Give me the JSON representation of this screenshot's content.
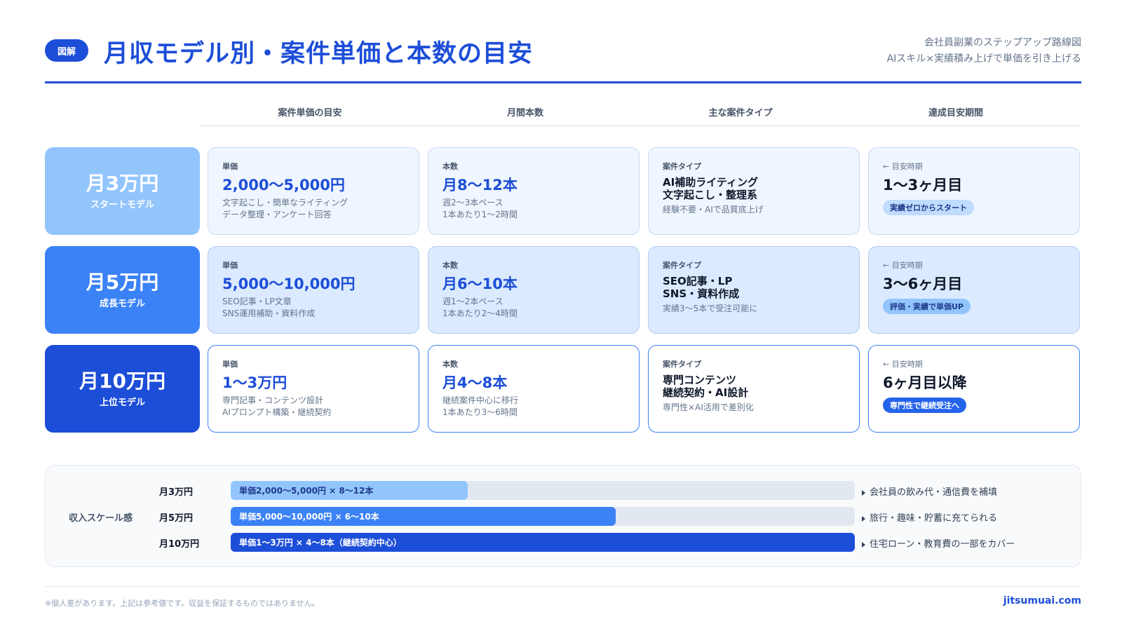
{
  "header": {
    "badge": "図解",
    "title": "月収モデル別・案件単価と本数の目安",
    "subtitle_line1": "会社員副業のステップアップ路線図",
    "subtitle_line2": "AIスキル×実績積み上げで単価を引き上げる"
  },
  "columns": [
    "案件単価の目安",
    "月間本数",
    "主な案件タイプ",
    "達成目安期間"
  ],
  "models": [
    {
      "amount": "月3万円",
      "name": "スタートモデル",
      "color": "#93c5fd",
      "text_color": "#ffffff",
      "price_label": "単価",
      "price": "2,000〜5,000円",
      "price_note1": "文字起こし・簡単なライティング",
      "price_note2": "データ整理・アンケート回答",
      "count_label": "本数",
      "count": "月8〜12本",
      "count_note1": "週2〜3本ペース",
      "count_note2": "1本あたり1〜2時間",
      "type_label": "案件タイプ",
      "type_line1": "AI補助ライティング",
      "type_line2": "文字起こし・整理系",
      "type_note": "経験不要・AIで品質底上げ",
      "period_label": "← 目安時期",
      "period": "1〜3ヶ月目",
      "pill": "実績ゼロからスタート",
      "pill_bg": "#bfdbfe",
      "pill_fg": "#1e3a8a"
    },
    {
      "amount": "月5万円",
      "name": "成長モデル",
      "color": "#3b82f6",
      "text_color": "#ffffff",
      "price_label": "単価",
      "price": "5,000〜10,000円",
      "price_note1": "SEO記事・LP文章",
      "price_note2": "SNS運用補助・資料作成",
      "count_label": "本数",
      "count": "月6〜10本",
      "count_note1": "週1〜2本ペース",
      "count_note2": "1本あたり2〜4時間",
      "type_label": "案件タイプ",
      "type_line1": "SEO記事・LP",
      "type_line2": "SNS・資料作成",
      "type_note": "実績3〜5本で受注可能に",
      "period_label": "← 目安時期",
      "period": "3〜6ヶ月目",
      "pill": "評価・実績で単価UP",
      "pill_bg": "#93c5fd",
      "pill_fg": "#1e3a8a"
    },
    {
      "amount": "月10万円",
      "name": "上位モデル",
      "color": "#1d4ed8",
      "text_color": "#ffffff",
      "price_label": "単価",
      "price": "1〜3万円",
      "price_note1": "専門記事・コンテンツ設計",
      "price_note2": "AIプロンプト構築・継続契約",
      "count_label": "本数",
      "count": "月4〜8本",
      "count_note1": "継続案件中心に移行",
      "count_note2": "1本あたり3〜6時間",
      "type_label": "案件タイプ",
      "type_line1": "専門コンテンツ",
      "type_line2": "継続契約・AI設計",
      "type_note": "専門性×AI活用で差別化",
      "period_label": "← 目安時期",
      "period": "6ヶ月目以降",
      "pill": "専門性で継続受注へ",
      "pill_bg": "#2563eb",
      "pill_fg": "#ffffff"
    }
  ],
  "scale": {
    "title": "収入スケール感",
    "rows": [
      {
        "label": "月3万円",
        "bar_text": "単価2,000〜5,000円 × 8〜12本",
        "fraction": 0.38,
        "color": "#93c5fd",
        "text_color": "#1e3a8a",
        "desc": "会社員の飲み代・通信費を補填"
      },
      {
        "label": "月5万円",
        "bar_text": "単価5,000〜10,000円 × 6〜10本",
        "fraction": 0.617,
        "color": "#3b82f6",
        "text_color": "#ffffff",
        "desc": "旅行・趣味・貯蓄に充てられる"
      },
      {
        "label": "月10万円",
        "bar_text": "単価1〜3万円 × 4〜8本（継続契約中心）",
        "fraction": 1.0,
        "color": "#1d4ed8",
        "text_color": "#ffffff",
        "desc": "住宅ローン・教育費の一部をカバー"
      }
    ]
  },
  "footer": {
    "disclaimer": "※個人差があります。上記は参考値です。収益を保証するものではありません。",
    "site": "jitsumuai.com"
  }
}
